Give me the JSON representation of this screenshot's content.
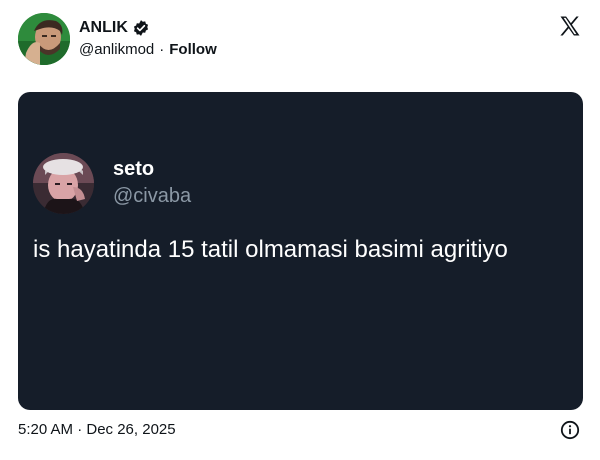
{
  "tweet": {
    "author": {
      "name": "ANLIK",
      "handle": "@anlikmod",
      "verified_icon": "verified-badge-icon",
      "avatar_icon": "avatar"
    },
    "separator": "·",
    "follow_label": "Follow",
    "brand_icon": "x-logo-icon",
    "timestamp": "5:20 AM · Dec 26, 2025",
    "info_icon": "info-icon"
  },
  "embedded": {
    "author": {
      "name": "seto",
      "handle": "@civaba"
    },
    "text": "is hayatinda 15 tatil olmamasi basimi agritiyo"
  },
  "colors": {
    "card_background": "#151d29",
    "embedded_handle": "#8b98a5",
    "text_primary": "#0f1419"
  }
}
